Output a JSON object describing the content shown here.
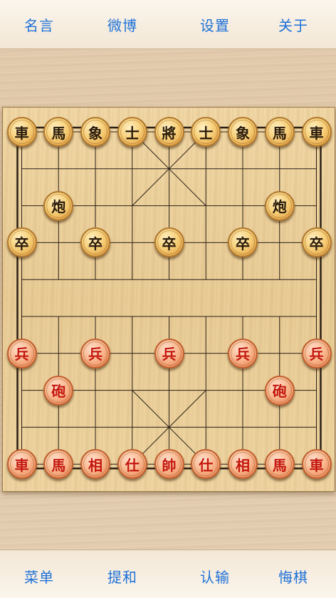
{
  "top_nav": {
    "items": [
      {
        "label": "名言",
        "name": "quotes-button"
      },
      {
        "label": "微博",
        "name": "weibo-button"
      },
      {
        "label": "设置",
        "name": "settings-button"
      },
      {
        "label": "关于",
        "name": "about-button"
      }
    ]
  },
  "bottom_nav": {
    "items": [
      {
        "label": "菜单",
        "name": "menu-button"
      },
      {
        "label": "提和",
        "name": "propose-draw-button"
      },
      {
        "label": "认输",
        "name": "resign-button"
      },
      {
        "label": "悔棋",
        "name": "undo-move-button"
      }
    ]
  },
  "colors": {
    "nav_text": "#1e72d8",
    "black_piece_text": "#2a1a0a",
    "red_piece_text": "#c4160d",
    "board_line": "#2b2016"
  },
  "board": {
    "files": 9,
    "ranks": 10,
    "pieces": [
      {
        "char": "車",
        "side": "black",
        "file": 0,
        "rank": 0
      },
      {
        "char": "馬",
        "side": "black",
        "file": 1,
        "rank": 0
      },
      {
        "char": "象",
        "side": "black",
        "file": 2,
        "rank": 0
      },
      {
        "char": "士",
        "side": "black",
        "file": 3,
        "rank": 0
      },
      {
        "char": "將",
        "side": "black",
        "file": 4,
        "rank": 0
      },
      {
        "char": "士",
        "side": "black",
        "file": 5,
        "rank": 0
      },
      {
        "char": "象",
        "side": "black",
        "file": 6,
        "rank": 0
      },
      {
        "char": "馬",
        "side": "black",
        "file": 7,
        "rank": 0
      },
      {
        "char": "車",
        "side": "black",
        "file": 8,
        "rank": 0
      },
      {
        "char": "炮",
        "side": "black",
        "file": 1,
        "rank": 2
      },
      {
        "char": "炮",
        "side": "black",
        "file": 7,
        "rank": 2
      },
      {
        "char": "卒",
        "side": "black",
        "file": 0,
        "rank": 3
      },
      {
        "char": "卒",
        "side": "black",
        "file": 2,
        "rank": 3
      },
      {
        "char": "卒",
        "side": "black",
        "file": 4,
        "rank": 3
      },
      {
        "char": "卒",
        "side": "black",
        "file": 6,
        "rank": 3
      },
      {
        "char": "卒",
        "side": "black",
        "file": 8,
        "rank": 3
      },
      {
        "char": "兵",
        "side": "red",
        "file": 0,
        "rank": 6
      },
      {
        "char": "兵",
        "side": "red",
        "file": 2,
        "rank": 6
      },
      {
        "char": "兵",
        "side": "red",
        "file": 4,
        "rank": 6
      },
      {
        "char": "兵",
        "side": "red",
        "file": 6,
        "rank": 6
      },
      {
        "char": "兵",
        "side": "red",
        "file": 8,
        "rank": 6
      },
      {
        "char": "砲",
        "side": "red",
        "file": 1,
        "rank": 7
      },
      {
        "char": "砲",
        "side": "red",
        "file": 7,
        "rank": 7
      },
      {
        "char": "車",
        "side": "red",
        "file": 0,
        "rank": 9
      },
      {
        "char": "馬",
        "side": "red",
        "file": 1,
        "rank": 9
      },
      {
        "char": "相",
        "side": "red",
        "file": 2,
        "rank": 9
      },
      {
        "char": "仕",
        "side": "red",
        "file": 3,
        "rank": 9
      },
      {
        "char": "帥",
        "side": "red",
        "file": 4,
        "rank": 9
      },
      {
        "char": "仕",
        "side": "red",
        "file": 5,
        "rank": 9
      },
      {
        "char": "相",
        "side": "red",
        "file": 6,
        "rank": 9
      },
      {
        "char": "馬",
        "side": "red",
        "file": 7,
        "rank": 9
      },
      {
        "char": "車",
        "side": "red",
        "file": 8,
        "rank": 9
      }
    ]
  }
}
